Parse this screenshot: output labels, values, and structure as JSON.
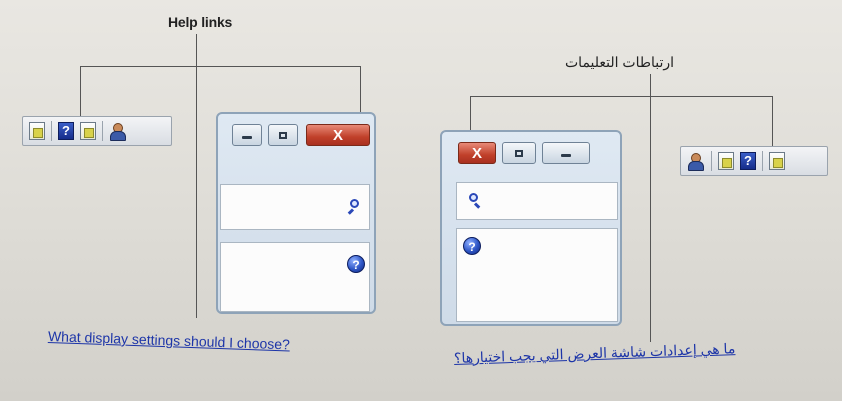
{
  "english": {
    "callout_label": "Help links",
    "link_text": "What display settings should I choose?",
    "window_close_glyph": "X"
  },
  "arabic": {
    "callout_label": "ارتباطات التعليمات",
    "link_text": "ما هي إعدادات شاشة العرض التي يجب اختيارها؟",
    "window_close_glyph": "X"
  },
  "icons": {
    "help_glyph": "?",
    "toolbar_left": [
      "document-icon",
      "help-icon",
      "document-icon",
      "person-icon"
    ],
    "toolbar_right": [
      "person-icon",
      "document-icon",
      "help-icon",
      "document-icon"
    ]
  },
  "colors": {
    "link": "#1d35a8",
    "close_button": "#c0402a",
    "help_icon": "#2e56c6"
  }
}
